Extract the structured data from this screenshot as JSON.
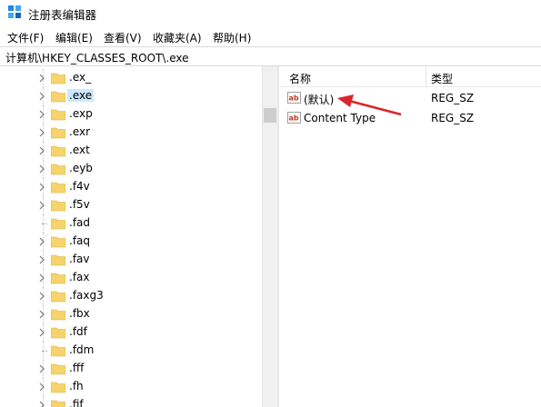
{
  "window": {
    "title": "注册表编辑器"
  },
  "menu": [
    "文件(F)",
    "编辑(E)",
    "查看(V)",
    "收藏夹(A)",
    "帮助(H)"
  ],
  "address": "计算机\\HKEY_CLASSES_ROOT\\.exe",
  "tree": {
    "items": [
      {
        "label": ".ex_",
        "expandable": true
      },
      {
        "label": ".exe",
        "expandable": true,
        "selected": true
      },
      {
        "label": ".exp",
        "expandable": true
      },
      {
        "label": ".exr",
        "expandable": true
      },
      {
        "label": ".ext",
        "expandable": true
      },
      {
        "label": ".eyb",
        "expandable": true
      },
      {
        "label": ".f4v",
        "expandable": true
      },
      {
        "label": ".f5v",
        "expandable": true
      },
      {
        "label": ".fad",
        "expandable": false
      },
      {
        "label": ".faq",
        "expandable": true
      },
      {
        "label": ".fav",
        "expandable": true
      },
      {
        "label": ".fax",
        "expandable": true
      },
      {
        "label": ".faxg3",
        "expandable": true
      },
      {
        "label": ".fbx",
        "expandable": true
      },
      {
        "label": ".fdf",
        "expandable": true
      },
      {
        "label": ".fdm",
        "expandable": false
      },
      {
        "label": ".fff",
        "expandable": true
      },
      {
        "label": ".fh",
        "expandable": true
      },
      {
        "label": ".fif",
        "expandable": true
      }
    ]
  },
  "list": {
    "columns": [
      "名称",
      "类型"
    ],
    "rows": [
      {
        "name": "(默认)",
        "type": "REG_SZ"
      },
      {
        "name": "Content Type",
        "type": "REG_SZ"
      }
    ]
  },
  "colors": {
    "folder": "#f6d36b",
    "selection": "#cce8ff",
    "arrow": "#d9262c",
    "ab_icon": "#c0392b"
  },
  "icons": {
    "app": "regedit-icon",
    "folder": "folder-icon",
    "value": "string-value-icon",
    "chevron": "chevron-right-icon"
  }
}
